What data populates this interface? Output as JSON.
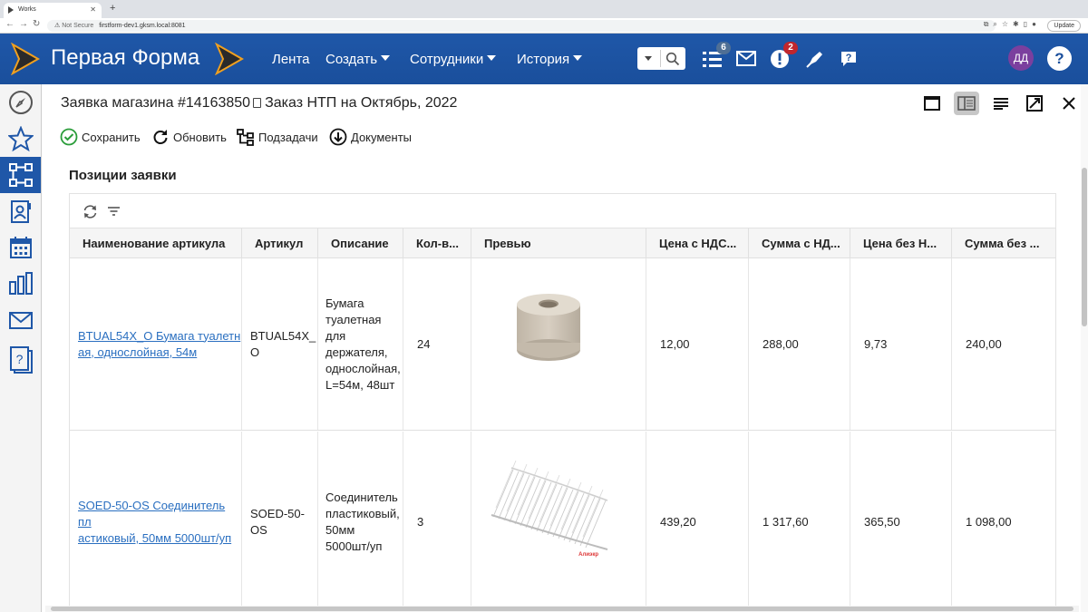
{
  "browser": {
    "tab_title": "Works",
    "url_security": "Not Secure",
    "url": "firstform-dev1.gksm.local:8081",
    "update_label": "Update"
  },
  "header": {
    "brand": "Первая Форма",
    "nav": [
      {
        "label": "Лента",
        "has_caret": false
      },
      {
        "label": "Создать",
        "has_caret": true
      },
      {
        "label": "Сотрудники",
        "has_caret": true
      },
      {
        "label": "История",
        "has_caret": true
      }
    ],
    "tasks_badge": "6",
    "alerts_badge": "2",
    "avatar_initials": "ДД",
    "colors": {
      "bar": "#1f57a8",
      "badge_tasks": "#4f6f95",
      "badge_alerts": "#c0262d",
      "avatar": "#7b3f9e"
    }
  },
  "sidebar": {
    "items": [
      {
        "icon": "compass-icon"
      },
      {
        "icon": "star-icon"
      },
      {
        "icon": "structure-icon",
        "active": true
      },
      {
        "icon": "contact-card-icon"
      },
      {
        "icon": "calendar-icon"
      },
      {
        "icon": "bar-chart-icon"
      },
      {
        "icon": "envelope-icon"
      },
      {
        "icon": "help-document-icon"
      }
    ]
  },
  "document": {
    "title_main": "Заявка магазина #14163850",
    "title_sub": "Заказ НТП на Октябрь, 2022",
    "toolbar": {
      "save": "Сохранить",
      "refresh": "Обновить",
      "subtasks": "Подзадачи",
      "documents": "Документы"
    },
    "section_title": "Позиции заявки"
  },
  "table": {
    "columns": [
      "Наименование артикула",
      "Артикул",
      "Описание",
      "Кол-в...",
      "Превью",
      "Цена с НДС...",
      "Сумма с НД...",
      "Цена без Н...",
      "Сумма без ..."
    ],
    "rows": [
      {
        "name_line1": "BTUAL54X_O Бумага туалетн",
        "name_line2": "ая, однослойная, 54м",
        "article_line1": "BTUAL54X_",
        "article_line2": "O",
        "desc": [
          "Бумага",
          "туалетная для",
          "держателя,",
          "однослойная,",
          "L=54м, 48шт"
        ],
        "qty": "24",
        "preview": "toilet-paper-roll",
        "price_vat": "12,00",
        "sum_vat": "288,00",
        "price_novat": "9,73",
        "sum_novat": "240,00"
      },
      {
        "name_line1": "SOED-50-OS Соединитель пл",
        "name_line2": "астиковый, 50мм 5000шт/уп",
        "article_line1": "SOED-50-",
        "article_line2": "OS",
        "desc": [
          "Соединитель",
          "пластиковый,",
          "50мм",
          "5000шт/уп"
        ],
        "qty": "3",
        "preview": "plastic-connectors",
        "preview_caption": "Алиэкр",
        "price_vat": "439,20",
        "sum_vat": "1 317,60",
        "price_novat": "365,50",
        "sum_novat": "1 098,00"
      }
    ]
  }
}
